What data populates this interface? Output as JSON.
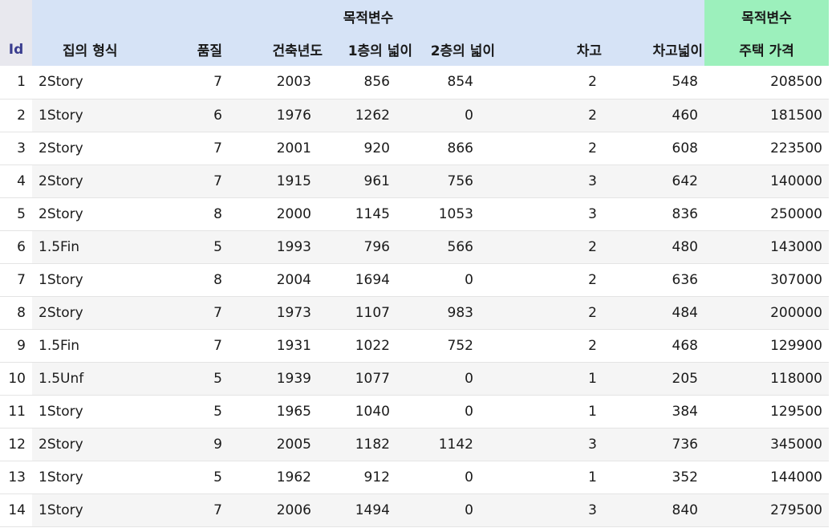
{
  "header": {
    "group_features": "목적변수",
    "group_target": "목적변수",
    "columns": [
      "Id",
      "집의 형식",
      "품질",
      "건축년도",
      "1층의 넓이",
      "2층의 넓이",
      "차고",
      "차고넓이",
      "주택 가격"
    ]
  },
  "rows": [
    [
      "1",
      "2Story",
      "7",
      "2003",
      "856",
      "854",
      "2",
      "548",
      "208500"
    ],
    [
      "2",
      "1Story",
      "6",
      "1976",
      "1262",
      "0",
      "2",
      "460",
      "181500"
    ],
    [
      "3",
      "2Story",
      "7",
      "2001",
      "920",
      "866",
      "2",
      "608",
      "223500"
    ],
    [
      "4",
      "2Story",
      "7",
      "1915",
      "961",
      "756",
      "3",
      "642",
      "140000"
    ],
    [
      "5",
      "2Story",
      "8",
      "2000",
      "1145",
      "1053",
      "3",
      "836",
      "250000"
    ],
    [
      "6",
      "1.5Fin",
      "5",
      "1993",
      "796",
      "566",
      "2",
      "480",
      "143000"
    ],
    [
      "7",
      "1Story",
      "8",
      "2004",
      "1694",
      "0",
      "2",
      "636",
      "307000"
    ],
    [
      "8",
      "2Story",
      "7",
      "1973",
      "1107",
      "983",
      "2",
      "484",
      "200000"
    ],
    [
      "9",
      "1.5Fin",
      "7",
      "1931",
      "1022",
      "752",
      "2",
      "468",
      "129900"
    ],
    [
      "10",
      "1.5Unf",
      "5",
      "1939",
      "1077",
      "0",
      "1",
      "205",
      "118000"
    ],
    [
      "11",
      "1Story",
      "5",
      "1965",
      "1040",
      "0",
      "1",
      "384",
      "129500"
    ],
    [
      "12",
      "2Story",
      "9",
      "2005",
      "1182",
      "1142",
      "3",
      "736",
      "345000"
    ],
    [
      "13",
      "1Story",
      "5",
      "1962",
      "912",
      "0",
      "1",
      "352",
      "144000"
    ],
    [
      "14",
      "1Story",
      "7",
      "2006",
      "1494",
      "0",
      "3",
      "840",
      "279500"
    ]
  ]
}
